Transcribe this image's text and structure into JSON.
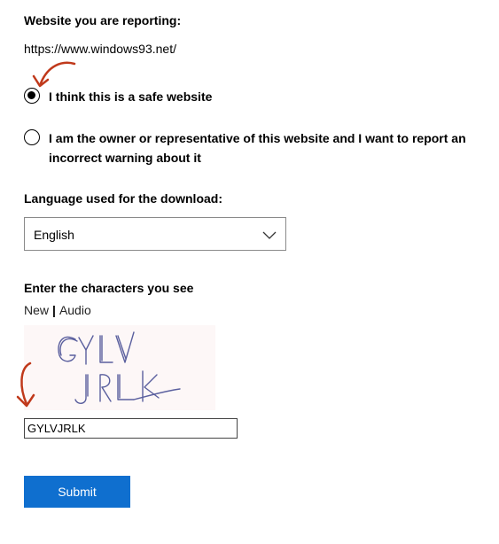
{
  "report": {
    "site_heading": "Website you are reporting:",
    "site_url": "https://www.windows93.net/"
  },
  "options": [
    {
      "label": "I think this is a safe website",
      "checked": true
    },
    {
      "label_line1": "I am the owner or representative of this website and I want to report an",
      "label_line2": "incorrect warning about it",
      "checked": false
    }
  ],
  "language": {
    "heading": "Language used for the download:",
    "selected": "English"
  },
  "captcha": {
    "heading": "Enter the characters you see",
    "new_link": "New",
    "separator": "|",
    "audio_link": "Audio",
    "image_text": "GYLVJRLK",
    "input_value": "GYLVJRLK"
  },
  "submit_label": "Submit",
  "colors": {
    "accent": "#0f6fcf",
    "annotation": "#c0391b"
  }
}
